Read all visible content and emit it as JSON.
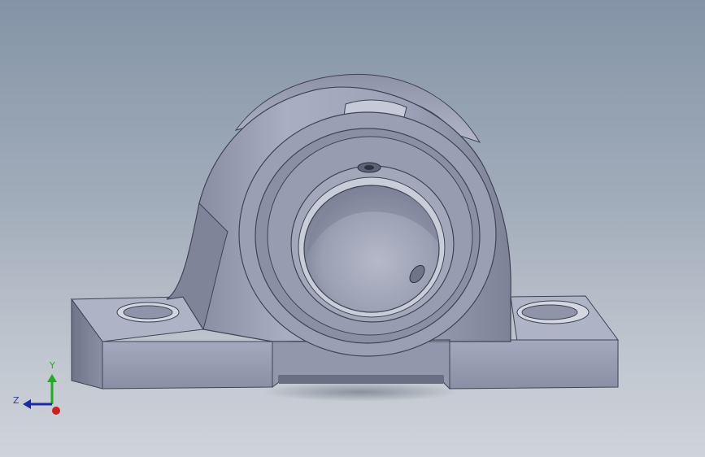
{
  "viewport": {
    "background_top": "#8494a6",
    "background_bottom": "#cfd3da",
    "model_color": "#9297ad"
  },
  "model": {
    "type": "pillow-block-bearing"
  },
  "triad": {
    "y_label": "Y",
    "z_label": "Z",
    "y_color": "#22aa22",
    "z_color": "#1a2aa8",
    "x_color": "#cc2020"
  }
}
